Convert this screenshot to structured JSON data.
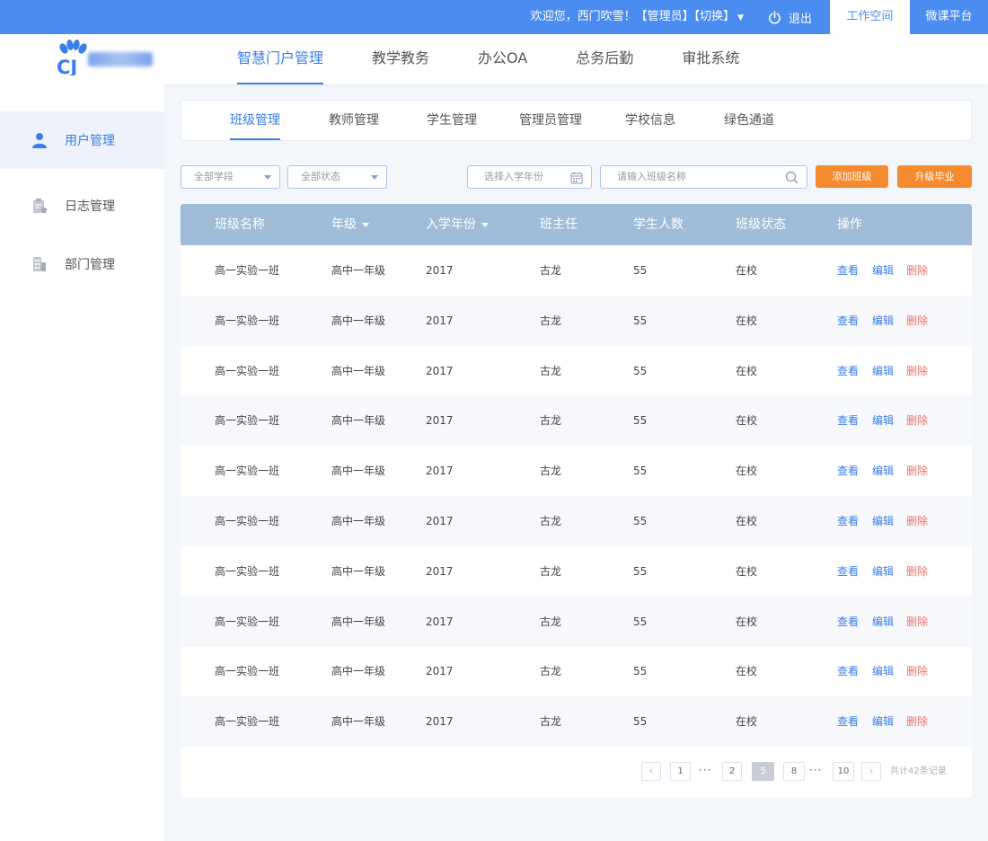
{
  "topbar": {
    "welcome": "欢迎您，西门吹雪！【管理员】【切换】",
    "logout": "退出",
    "workspace": "工作空间",
    "weike": "微课平台"
  },
  "logo": {
    "text": "CJ"
  },
  "main_nav": [
    "智慧门户管理",
    "教学教务",
    "办公OA",
    "总务后勤",
    "审批系统"
  ],
  "sidebar": [
    "用户管理",
    "日志管理",
    "部门管理"
  ],
  "sub_nav": [
    "班级管理",
    "教师管理",
    "学生管理",
    "管理员管理",
    "学校信息",
    "绿色通道"
  ],
  "filters": {
    "grade_select": "全部学段",
    "status_select": "全部状态",
    "year_placeholder": "选择入学年份",
    "search_placeholder": "请输入班级名称",
    "add_button": "添加班级",
    "upgrade_button": "升级毕业"
  },
  "table": {
    "headers": [
      "班级名称",
      "年级",
      "入学年份",
      "班主任",
      "学生人数",
      "班级状态",
      "操作"
    ],
    "rows": [
      [
        "高一实验一班",
        "高中一年级",
        "2017",
        "古龙",
        "55",
        "在校"
      ],
      [
        "高一实验一班",
        "高中一年级",
        "2017",
        "古龙",
        "55",
        "在校"
      ],
      [
        "高一实验一班",
        "高中一年级",
        "2017",
        "古龙",
        "55",
        "在校"
      ],
      [
        "高一实验一班",
        "高中一年级",
        "2017",
        "古龙",
        "55",
        "在校"
      ],
      [
        "高一实验一班",
        "高中一年级",
        "2017",
        "古龙",
        "55",
        "在校"
      ],
      [
        "高一实验一班",
        "高中一年级",
        "2017",
        "古龙",
        "55",
        "在校"
      ],
      [
        "高一实验一班",
        "高中一年级",
        "2017",
        "古龙",
        "55",
        "在校"
      ],
      [
        "高一实验一班",
        "高中一年级",
        "2017",
        "古龙",
        "55",
        "在校"
      ],
      [
        "高一实验一班",
        "高中一年级",
        "2017",
        "古龙",
        "55",
        "在校"
      ],
      [
        "高一实验一班",
        "高中一年级",
        "2017",
        "古龙",
        "55",
        "在校"
      ]
    ],
    "actions": [
      "查看",
      "编辑",
      "删除"
    ]
  },
  "pagination": {
    "pages": [
      "1",
      "2",
      "5",
      "8",
      "10"
    ],
    "current": "5",
    "ellipsis": "···",
    "total": "共计42条记录"
  },
  "colors": {
    "primary": "#4a8cf0",
    "accent_orange": "#f58a2e",
    "header_row": "#9fbcd8",
    "delete": "#f2706b"
  }
}
